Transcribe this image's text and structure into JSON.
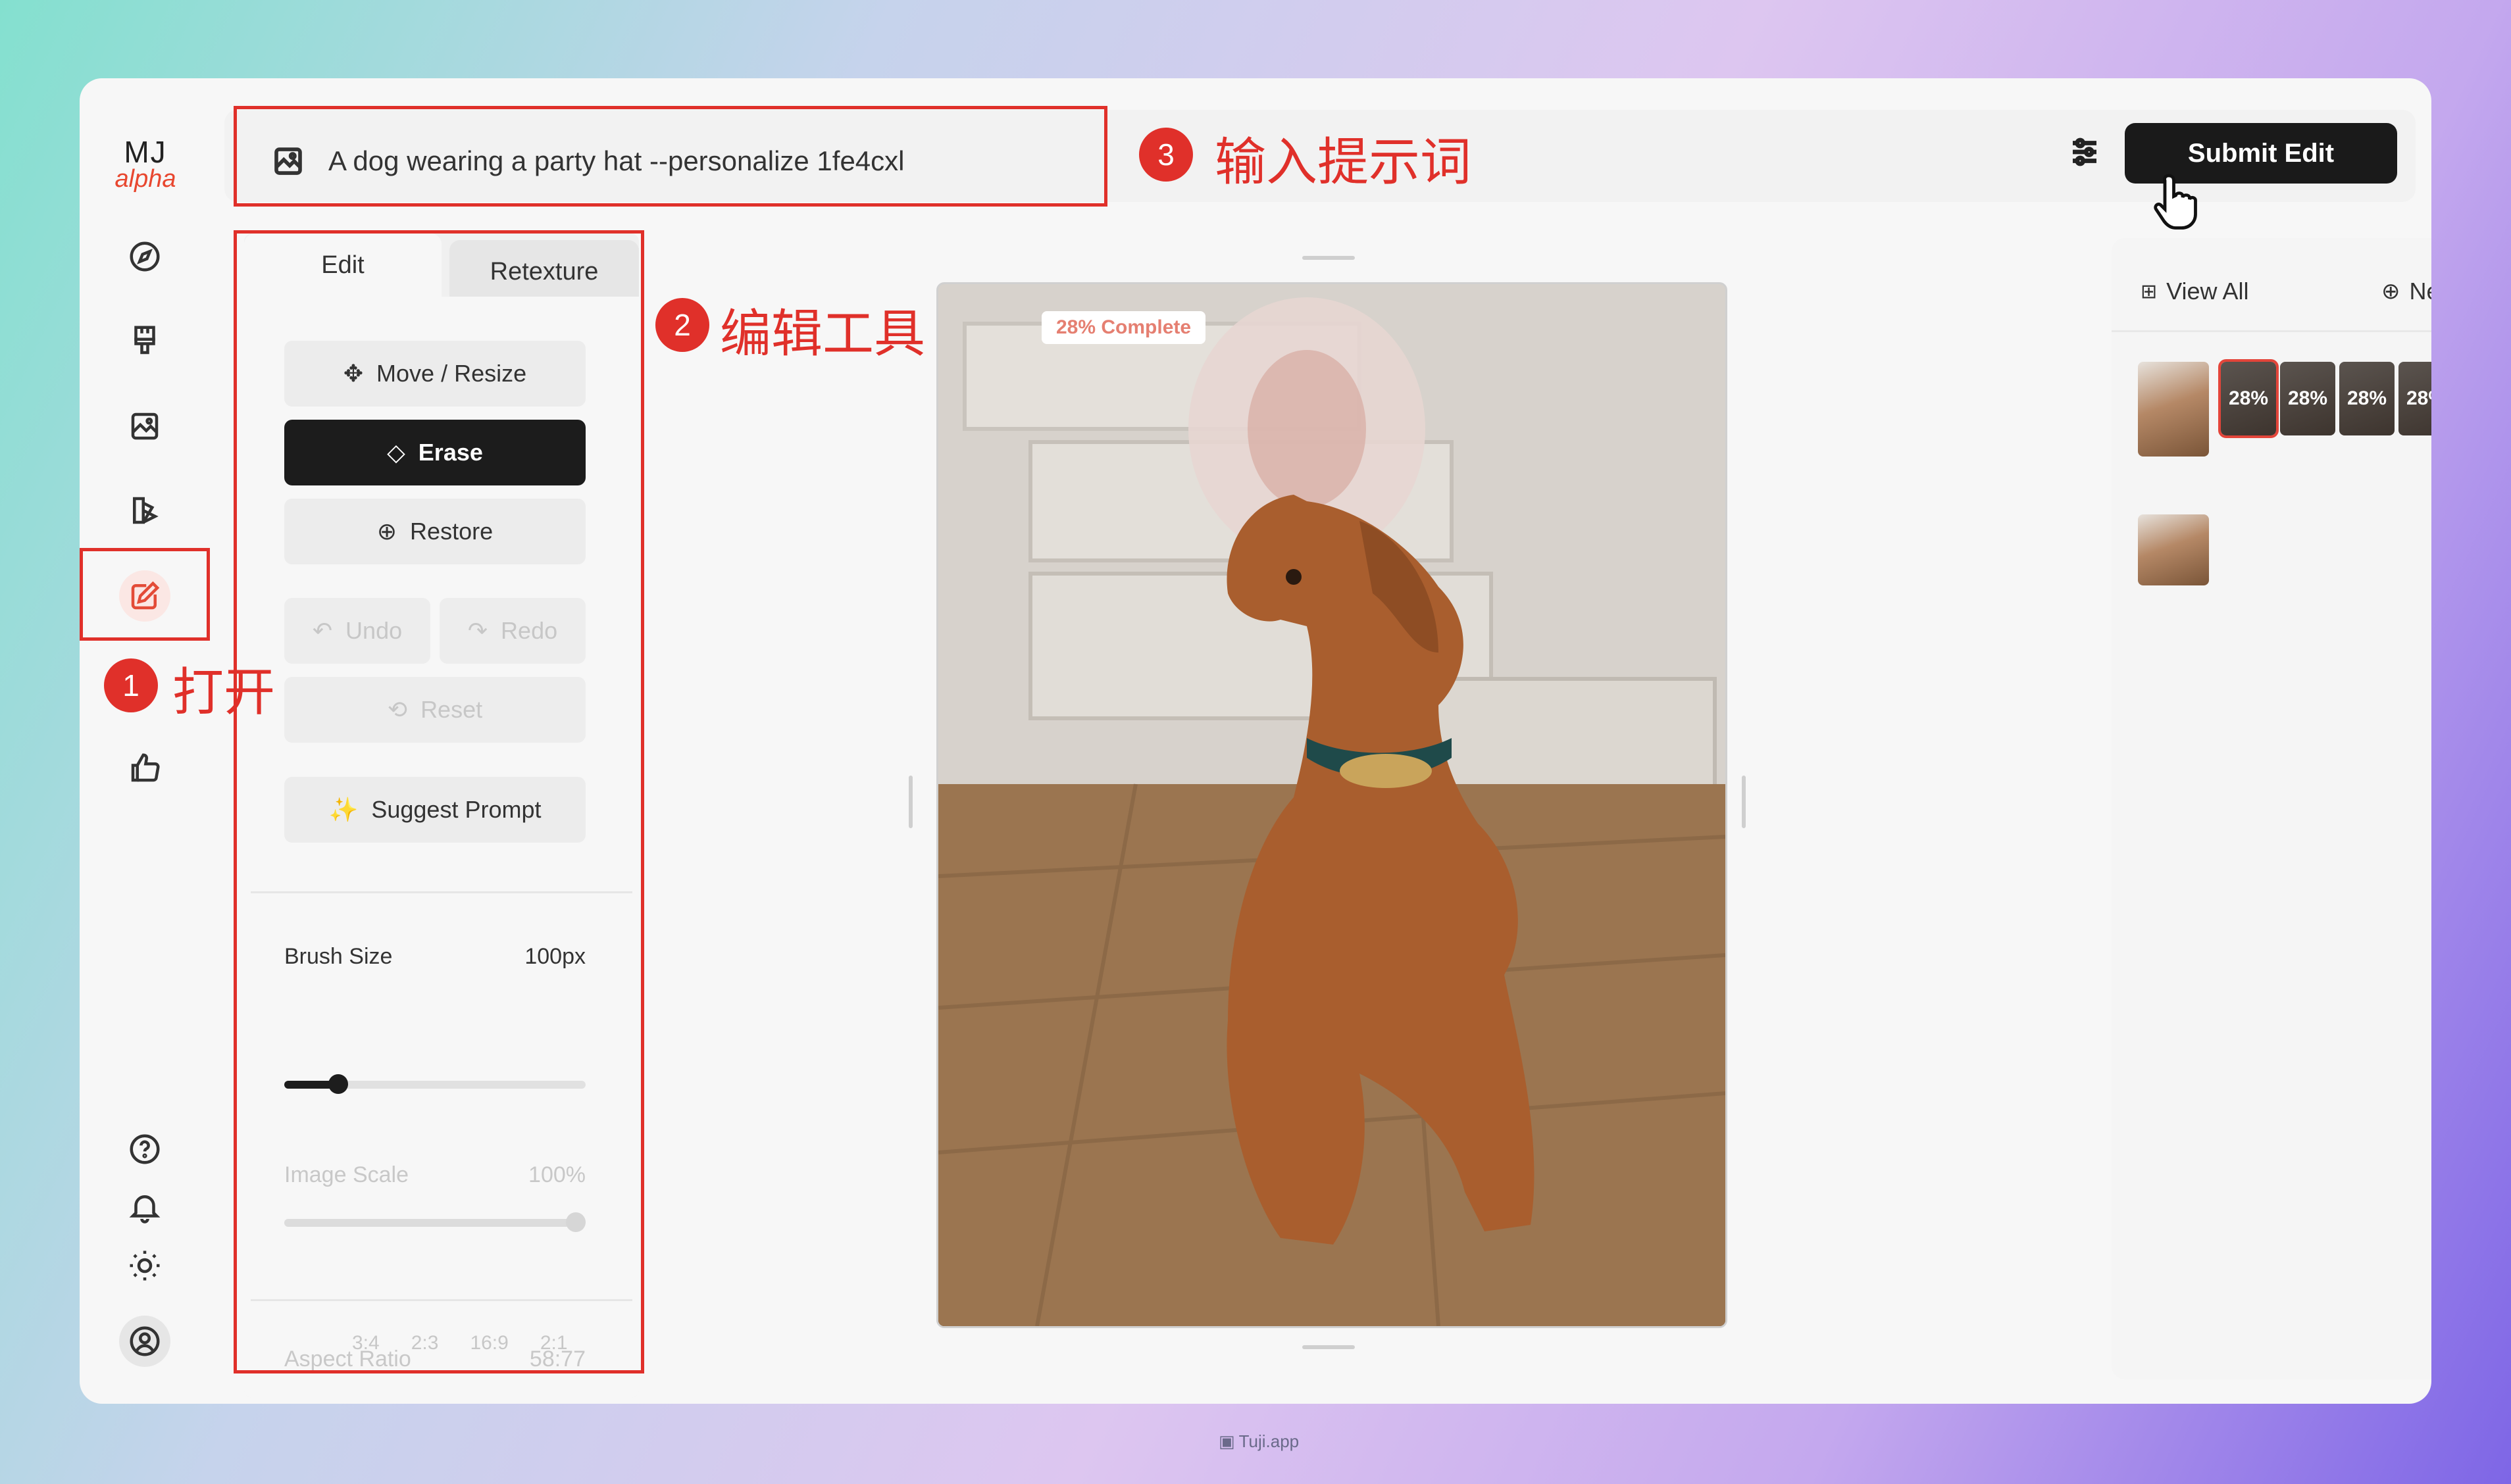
{
  "logo": {
    "line1": "MJ",
    "line2": "alpha"
  },
  "rail": {
    "icons": [
      "compass-icon",
      "paintbrush-icon",
      "image-icon",
      "layers-icon",
      "edit-icon",
      "thumbs-up-icon"
    ],
    "bottom_icons": [
      "help-icon",
      "bell-icon",
      "sun-icon",
      "user-icon"
    ]
  },
  "prompt": {
    "text": "A dog wearing a party hat --personalize 1fe4cxl"
  },
  "header": {
    "submit_label": "Submit Edit"
  },
  "panel": {
    "tabs": [
      "Edit",
      "Retexture"
    ],
    "move_resize": "Move / Resize",
    "erase": "Erase",
    "restore": "Restore",
    "undo": "Undo",
    "redo": "Redo",
    "reset": "Reset",
    "suggest": "Suggest Prompt",
    "brush_size_label": "Brush Size",
    "brush_size_value": "100px",
    "brush_fraction": 0.18,
    "image_scale_label": "Image Scale",
    "image_scale_value": "100%",
    "aspect_ratio_label": "Aspect Ratio",
    "aspect_ratio_value": "58:77",
    "ratios": [
      "3:4",
      "2:3",
      "16:9",
      "2:1"
    ]
  },
  "canvas": {
    "progress": "28% Complete"
  },
  "right": {
    "view_all": "View All",
    "new": "New",
    "thumb_percent": "28%"
  },
  "annotations": {
    "step1_num": "1",
    "step1_text": "打开",
    "step2_num": "2",
    "step2_text": "编辑工具",
    "step3_num": "3",
    "step3_text": "输入提示词",
    "color": "#e0302a"
  },
  "footer": {
    "watermark": "Tuji.app"
  }
}
